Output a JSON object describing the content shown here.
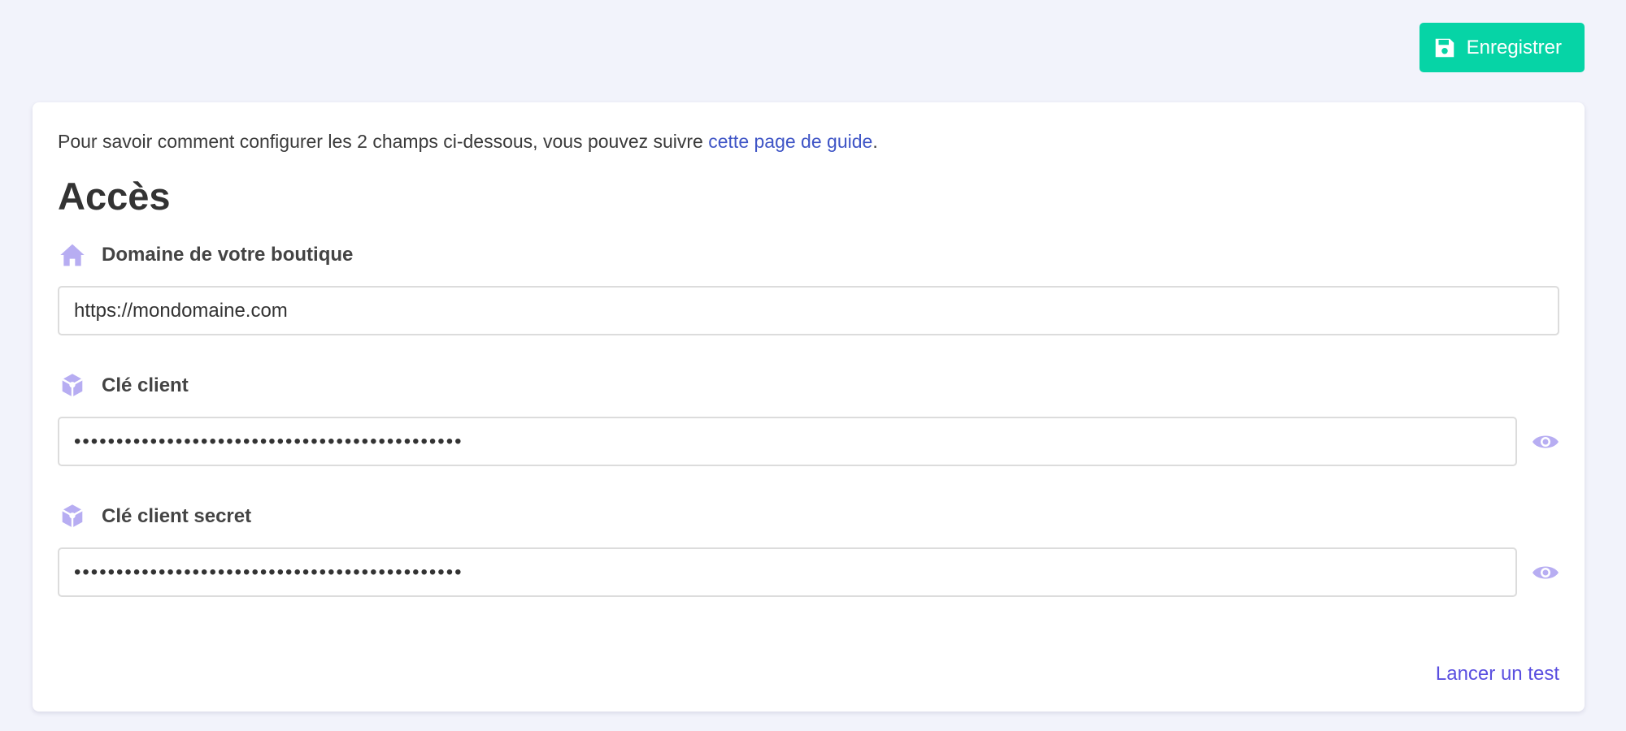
{
  "toolbar": {
    "save_label": "Enregistrer",
    "save_icon": "floppy-disk-icon",
    "save_color": "#06d4a6"
  },
  "card": {
    "intro_text": "Pour savoir comment configurer les 2 champs ci-dessous, vous pouvez suivre ",
    "intro_link": "cette page de guide",
    "intro_end": ".",
    "section_title": "Accès",
    "fields": [
      {
        "label": "Domaine de votre boutique",
        "icon": "home-icon",
        "value": "https://mondomaine.com",
        "masked": false
      },
      {
        "label": "Clé client",
        "icon": "cube-icon",
        "value": "••••••••••••••••••••••••••••••••••••••••••••••",
        "masked": true
      },
      {
        "label": "Clé client secret",
        "icon": "cube-icon",
        "value": "••••••••••••••••••••••••••••••••••••••••••••••",
        "masked": true
      }
    ],
    "test_link": "Lancer un test"
  },
  "colors": {
    "background": "#f2f3fb",
    "icon": "#b7adf2",
    "link": "#3f55c6",
    "test_link": "#5a4fe0"
  }
}
